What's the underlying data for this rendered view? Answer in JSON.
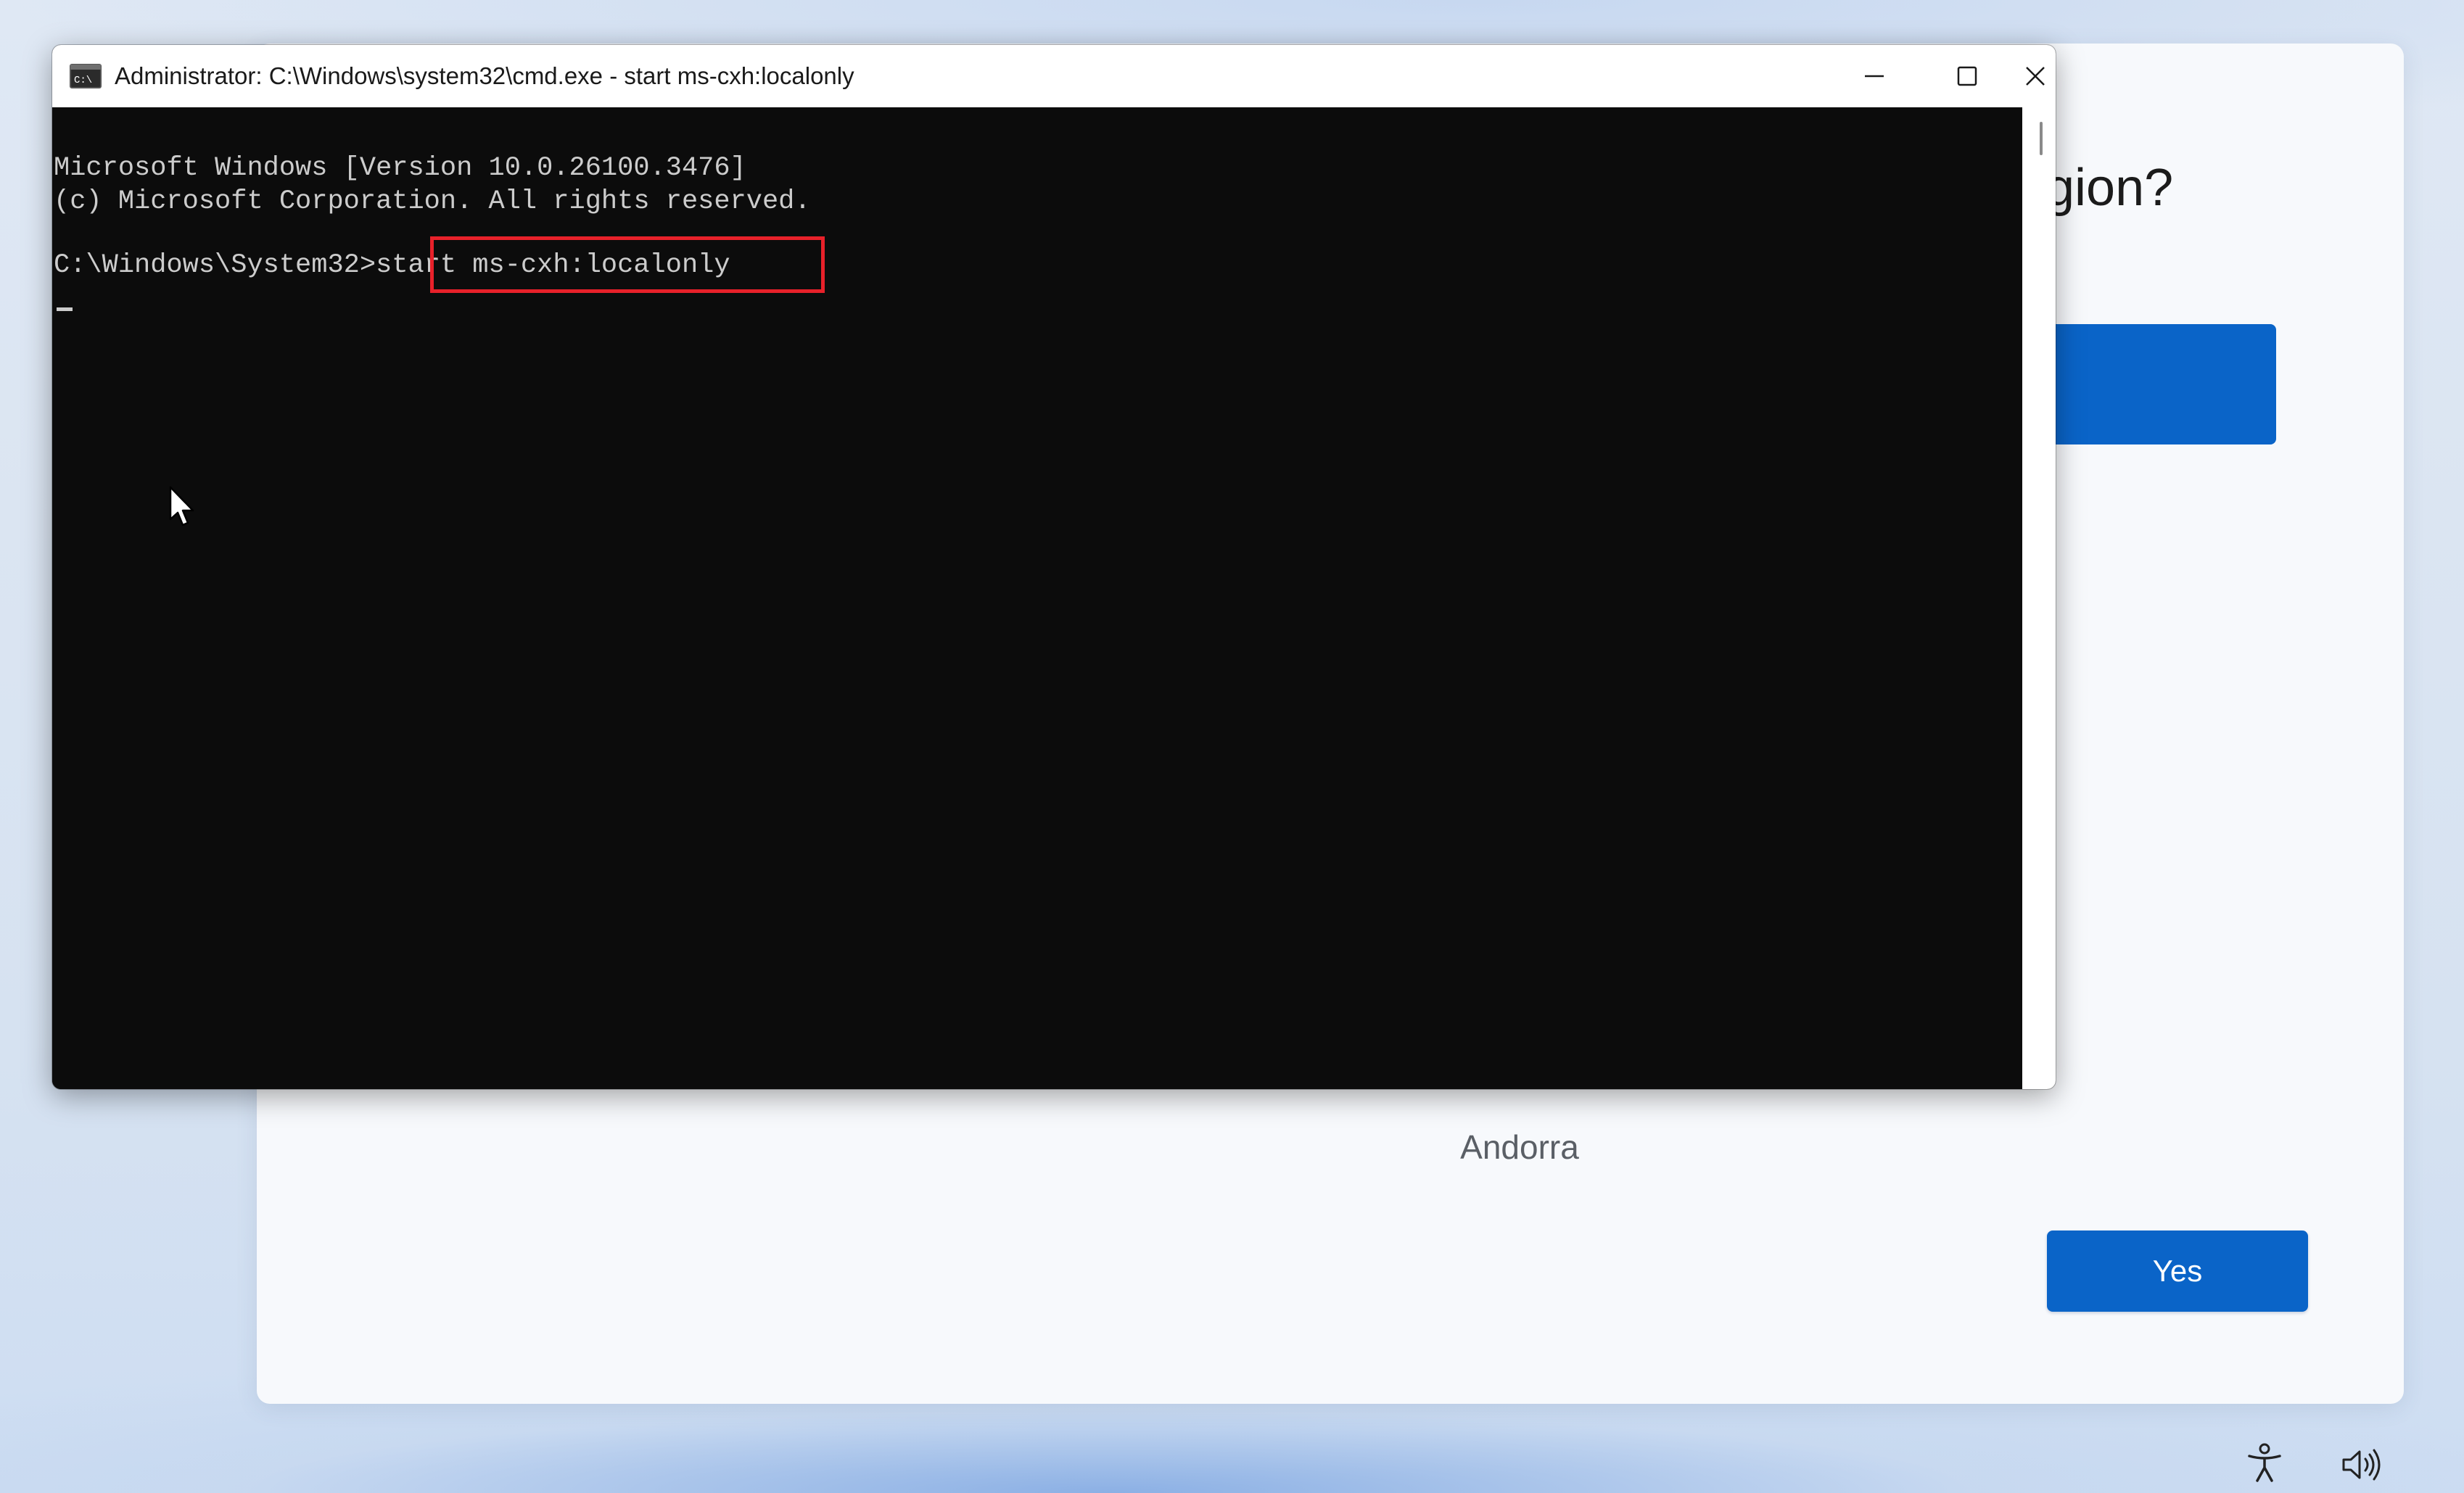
{
  "console": {
    "title": "Administrator: C:\\Windows\\system32\\cmd.exe - start  ms-cxh:localonly",
    "app_icon": "cmd-icon",
    "buttons": {
      "minimize_icon": "minimize-icon",
      "maximize_icon": "maximize-icon",
      "close_icon": "close-icon"
    },
    "lines": [
      "Microsoft Windows [Version 10.0.26100.3476]",
      "(c) Microsoft Corporation. All rights reserved.",
      "",
      "C:\\Windows\\System32>"
    ],
    "prompt": "C:\\Windows\\System32>",
    "command": "start ms-cxh:localonly",
    "highlight_color": "#e8212a",
    "background_color": "#0c0c0c",
    "text_color": "#cccccc"
  },
  "oobe": {
    "question_partial": "gion?",
    "visible_list_item": "Andorra",
    "yes_label": "Yes",
    "accent_color": "#0a64c8"
  },
  "tray": {
    "accessibility_icon": "accessibility-icon",
    "volume_icon": "volume-icon"
  }
}
